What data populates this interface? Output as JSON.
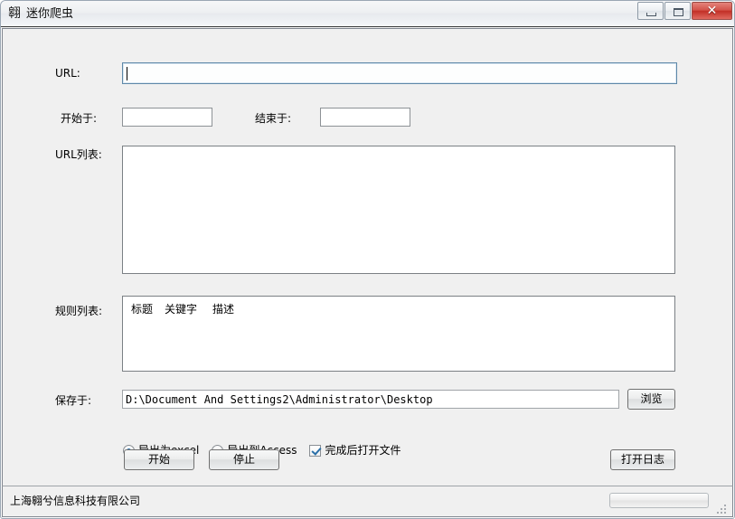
{
  "window": {
    "title": "迷你爬虫",
    "icon": "app-icon",
    "controls": {
      "minimize": "minimize-icon",
      "maximize": "maximize-icon",
      "close": "✕"
    }
  },
  "form": {
    "url": {
      "label": "URL:",
      "value": "",
      "placeholder": ""
    },
    "start_at": {
      "label": "开始于:",
      "value": "",
      "placeholder": ""
    },
    "end_at": {
      "label": "结束于:",
      "value": "",
      "placeholder": ""
    },
    "url_list": {
      "label": "URL列表:",
      "value": ""
    },
    "rule_list": {
      "label": "规则列表:",
      "columns": [
        "标题",
        "关键字",
        "描述"
      ],
      "rows": []
    },
    "save_to": {
      "label": "保存于:",
      "value": "D:\\Document And Settings2\\Administrator\\Desktop",
      "browse_label": "浏览"
    },
    "export_options": [
      {
        "label": "导出为excel",
        "selected": true
      },
      {
        "label": "导出到Access",
        "selected": false
      }
    ],
    "open_after_finish": {
      "label": "完成后打开文件",
      "checked": true
    }
  },
  "actions": {
    "start_label": "开始",
    "stop_label": "停止",
    "open_log_label": "打开日志"
  },
  "statusbar": {
    "text": "上海翱兮信息科技有限公司",
    "progress": 0
  }
}
